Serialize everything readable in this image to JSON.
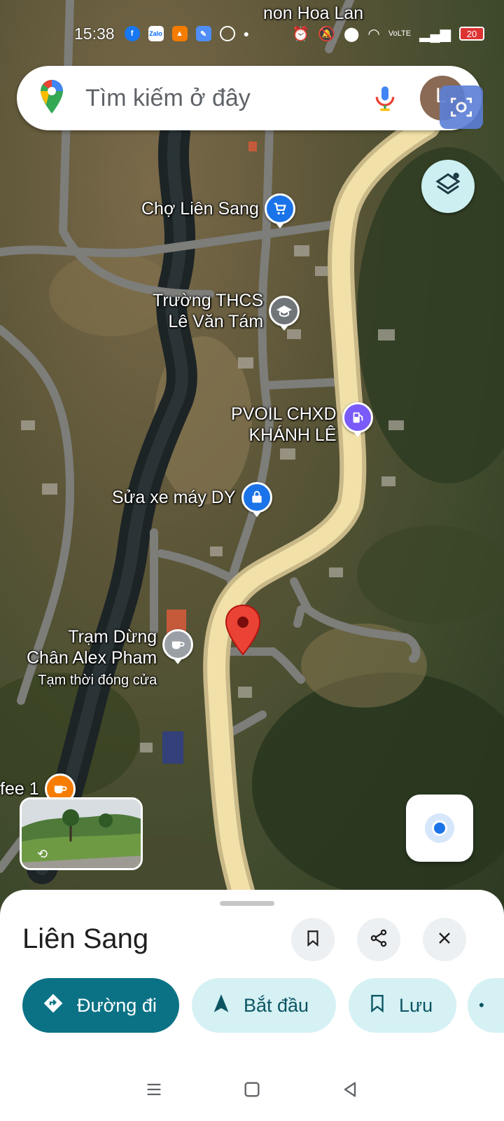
{
  "status_bar": {
    "time": "15:38",
    "network": "VoLTE",
    "battery": "20"
  },
  "map_labels": {
    "top_partial": "non Hoa Lan",
    "cho": "Chợ Liên Sang",
    "school_line1": "Trường THCS",
    "school_line2": "Lê Văn Tám",
    "gas_line1": "PVOIL CHXD",
    "gas_line2": "KHÁNH LÊ",
    "repair": "Sửa xe máy DY",
    "cafe_stop_line1": "Trạm Dừng",
    "cafe_stop_line2": "Chân Alex Pham",
    "cafe_stop_status": "Tạm thời đóng cửa",
    "cafe_left": "fee 1"
  },
  "search": {
    "placeholder": "Tìm kiếm ở đây",
    "avatar_letter": "L"
  },
  "sheet": {
    "title": "Liên Sang",
    "directions_label": "Đường đi",
    "start_label": "Bắt đầu",
    "save_label": "Lưu"
  },
  "colors": {
    "primary": "#0b7285",
    "secondary": "#d5f1f4",
    "pin_red": "#ea4335",
    "poi_blue": "#1a73e8",
    "poi_gray": "#70757a",
    "poi_purple": "#7a5af8",
    "poi_orange": "#f57c00"
  }
}
